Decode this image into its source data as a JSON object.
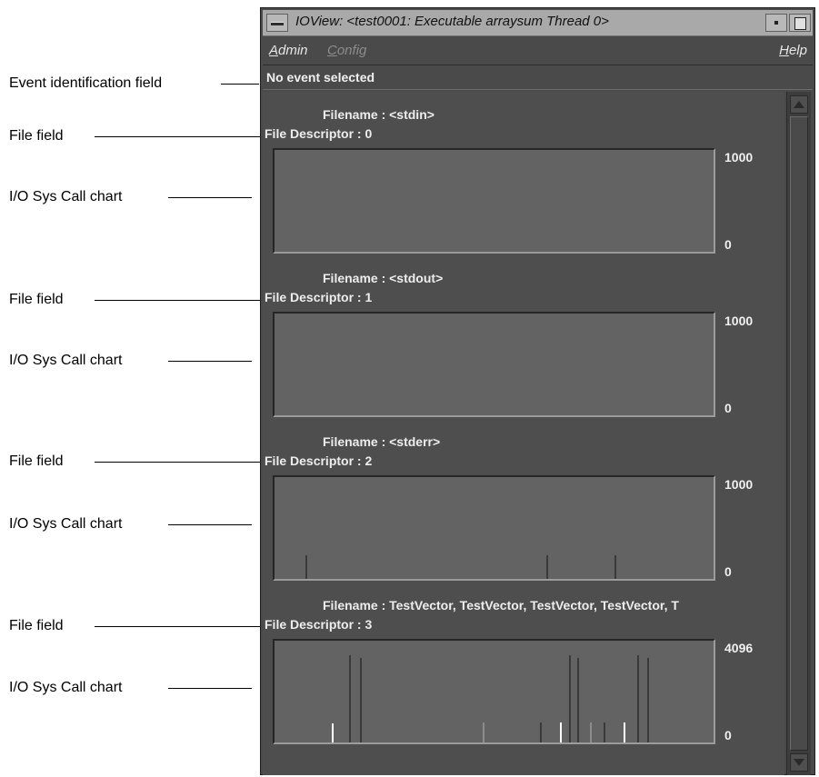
{
  "window": {
    "title": "IOView: <test0001: Executable arraysum Thread 0>"
  },
  "menubar": {
    "admin": {
      "mnemonic": "A",
      "rest": "dmin"
    },
    "config": {
      "mnemonic": "C",
      "rest": "onfig"
    },
    "help": {
      "mnemonic": "H",
      "rest": "elp"
    }
  },
  "event_field": "No event selected",
  "callouts": {
    "event": "Event identification field",
    "file": "File field",
    "chart": "I/O Sys Call chart"
  },
  "files": [
    {
      "filename": "Filename : <stdin>",
      "descriptor": "File Descriptor : 0",
      "axis_max": "1000",
      "axis_min": "0",
      "ymax": 1000,
      "ticks": []
    },
    {
      "filename": "Filename : <stdout>",
      "descriptor": "File Descriptor : 1",
      "axis_max": "1000",
      "axis_min": "0",
      "ymax": 1000,
      "ticks": []
    },
    {
      "filename": "Filename : <stderr>",
      "descriptor": "File Descriptor : 2",
      "axis_max": "1000",
      "axis_min": "0",
      "ymax": 1000,
      "ticks": [
        {
          "x": 0.07,
          "v": 230,
          "kind": "dark"
        },
        {
          "x": 0.62,
          "v": 230,
          "kind": "dark"
        },
        {
          "x": 0.775,
          "v": 230,
          "kind": "dark"
        }
      ]
    },
    {
      "filename": "Filename : TestVector, TestVector, TestVector, TestVector, T",
      "descriptor": "File Descriptor : 3",
      "axis_max": "4096",
      "axis_min": "0",
      "ymax": 4096,
      "ticks": [
        {
          "x": 0.13,
          "v": 760,
          "kind": "white"
        },
        {
          "x": 0.17,
          "v": 3500,
          "kind": "dark"
        },
        {
          "x": 0.195,
          "v": 3400,
          "kind": "dark"
        },
        {
          "x": 0.475,
          "v": 800,
          "kind": "light"
        },
        {
          "x": 0.605,
          "v": 800,
          "kind": "dark"
        },
        {
          "x": 0.65,
          "v": 800,
          "kind": "white"
        },
        {
          "x": 0.67,
          "v": 3500,
          "kind": "dark"
        },
        {
          "x": 0.69,
          "v": 3400,
          "kind": "dark"
        },
        {
          "x": 0.718,
          "v": 800,
          "kind": "light"
        },
        {
          "x": 0.75,
          "v": 800,
          "kind": "dark"
        },
        {
          "x": 0.795,
          "v": 800,
          "kind": "white"
        },
        {
          "x": 0.826,
          "v": 3500,
          "kind": "dark"
        },
        {
          "x": 0.848,
          "v": 3400,
          "kind": "dark"
        }
      ]
    }
  ],
  "colors": {
    "tick_dark": "#3a3a3a",
    "tick_light": "#8c8c8c",
    "tick_white": "#ffffff"
  }
}
